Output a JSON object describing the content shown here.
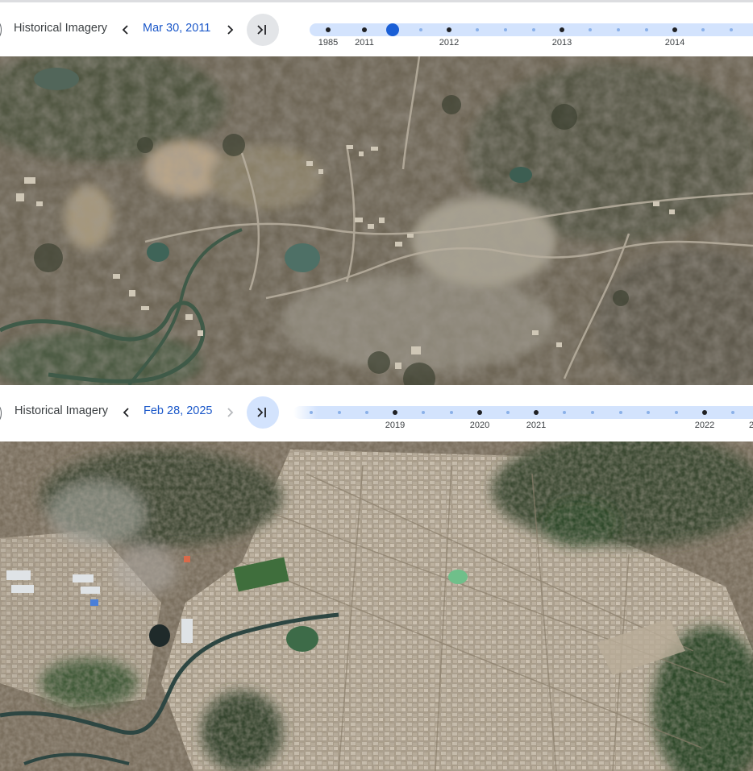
{
  "top": {
    "label": "Historical Imagery",
    "date": "Mar 30, 2011",
    "years": [
      "1985",
      "2011",
      "2012",
      "2013",
      "2014"
    ],
    "colors": {
      "active_date": "#1a57c9",
      "handle": "#1a5fd6",
      "track": "#d3e3fd",
      "latest_bg": "#e3e5e8"
    },
    "icons": {
      "prev": "chevron-left-icon",
      "next": "chevron-right-icon",
      "latest": "skip-to-latest-icon"
    }
  },
  "bottom": {
    "label": "Historical Imagery",
    "date": "Feb 28, 2025",
    "years": [
      "2019",
      "2020",
      "2021",
      "2022",
      "2"
    ],
    "colors": {
      "active_date": "#1a57c9",
      "track": "#d3e3fd",
      "latest_bg": "#d3e3fd"
    },
    "icons": {
      "prev": "chevron-left-icon",
      "next": "chevron-right-icon-disabled",
      "latest": "skip-to-latest-icon"
    }
  }
}
